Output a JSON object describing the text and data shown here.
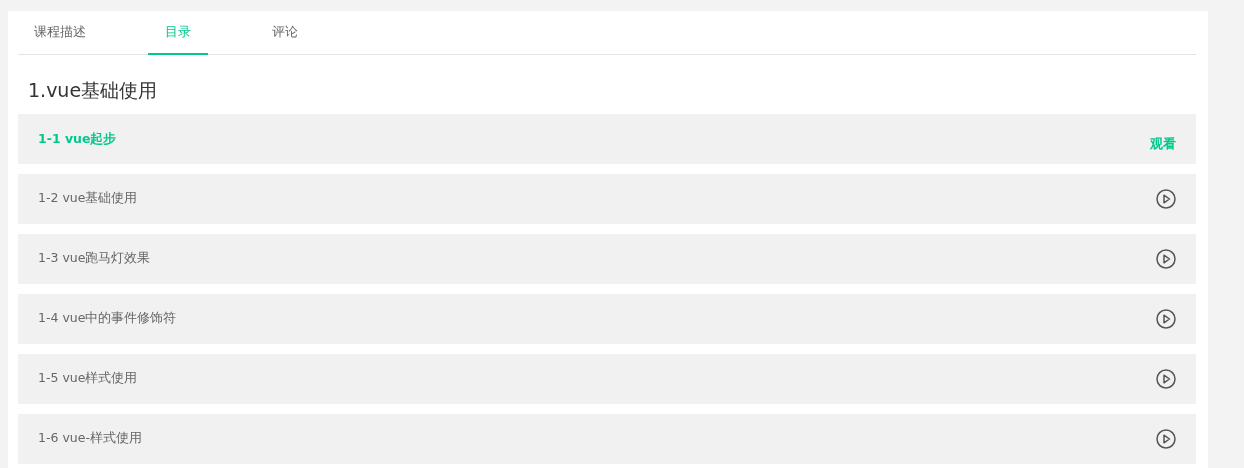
{
  "tabs": [
    {
      "label": "课程描述",
      "selected": false
    },
    {
      "label": "目录",
      "selected": true
    },
    {
      "label": "评论",
      "selected": false
    }
  ],
  "chapter": {
    "title": "1.vue基础使用"
  },
  "lessons": [
    {
      "label": "1-1 vue起步",
      "selected": true,
      "action": "观看"
    },
    {
      "label": "1-2 vue基础使用",
      "selected": false
    },
    {
      "label": "1-3 vue跑马灯效果",
      "selected": false
    },
    {
      "label": "1-4 vue中的事件修饰符",
      "selected": false
    },
    {
      "label": "1-5 vue样式使用",
      "selected": false
    },
    {
      "label": "1-6 vue-样式使用",
      "selected": false
    }
  ]
}
